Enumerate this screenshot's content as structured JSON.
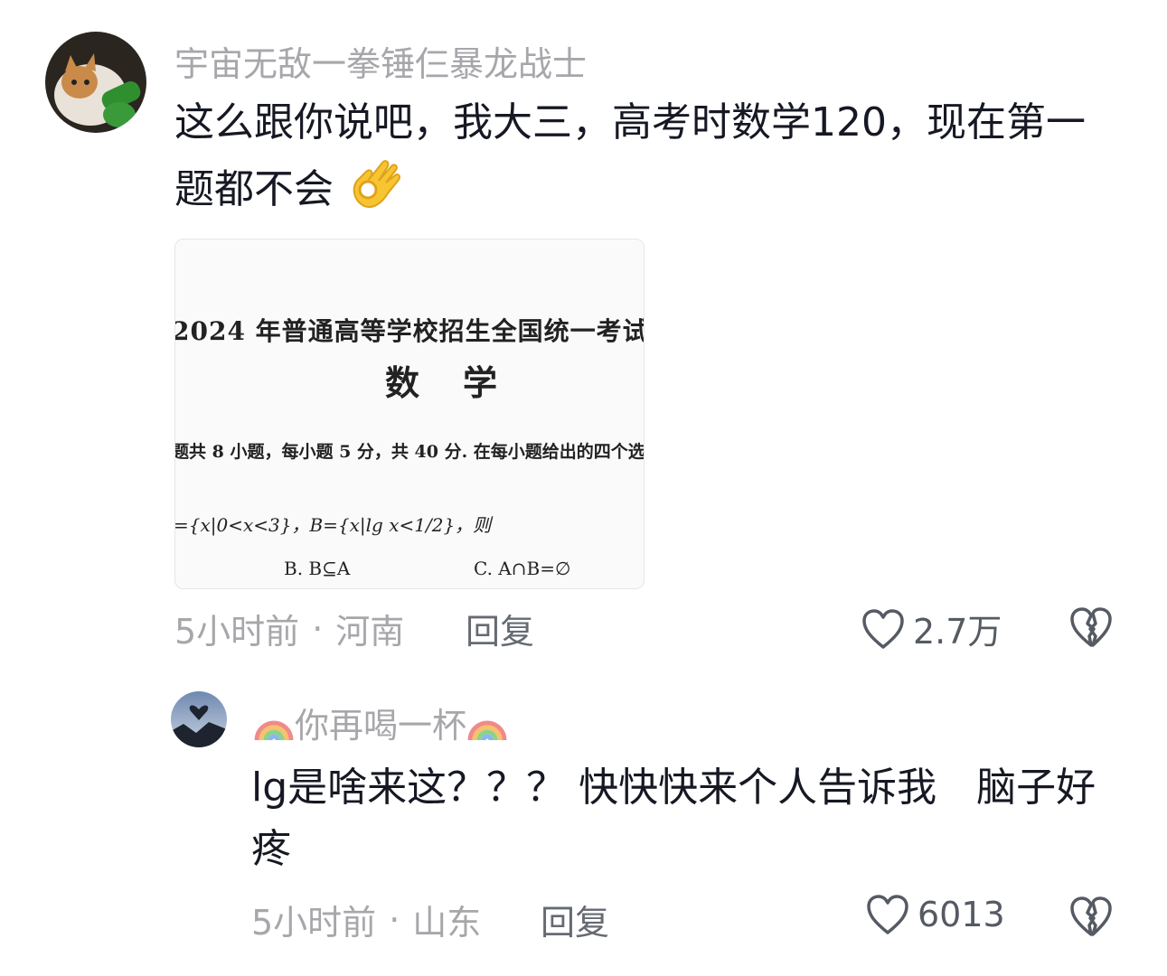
{
  "comments": [
    {
      "username": "宇宙无敌一拳锤仨暴龙战士",
      "text": "这么跟你说吧，我大三，高考时数学120，现在第一题都不会",
      "emoji": "ok-hand",
      "image": {
        "title": "2024 年普通高等学校招生全国统一考试",
        "subject": "数学",
        "instruction": "题共 8 小题，每小题 5 分，共 40 分. 在每小题给出的四个选",
        "question": "={x|0<x<3}，B={x|lg x<1/2}，则",
        "option_b": "B. B⊆A",
        "option_c": "C. A∩B=∅"
      },
      "time": "5小时前",
      "location": "河南",
      "reply_label": "回复",
      "likes": "2.7万"
    },
    {
      "username": "你再喝一杯",
      "text": "lg是啥来这？？？ 快快快来个人告诉我　脑子好疼",
      "time": "5小时前",
      "location": "山东",
      "reply_label": "回复",
      "likes": "6013"
    }
  ],
  "separator": "·",
  "colors": {
    "meta": "#a7a7ab",
    "text": "#161823",
    "icon": "#555a63"
  }
}
